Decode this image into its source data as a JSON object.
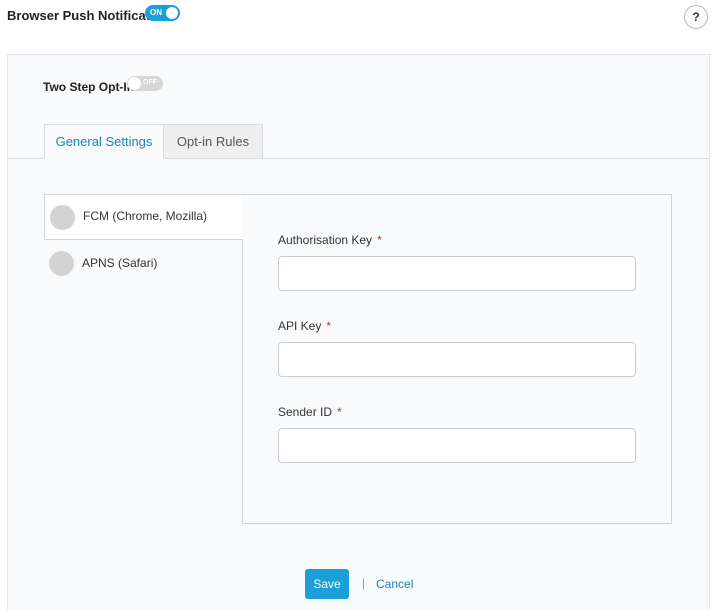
{
  "header": {
    "title": "Browser Push Notification",
    "toggle_label": "ON",
    "help_label": "?"
  },
  "two_step": {
    "label": "Two Step Opt-In",
    "toggle_label": "OFF"
  },
  "tabs": [
    {
      "label": "General Settings",
      "active": true
    },
    {
      "label": "Opt-in Rules",
      "active": false
    }
  ],
  "providers": [
    {
      "label": "FCM (Chrome, Mozilla)",
      "active": true
    },
    {
      "label": "APNS (Safari)",
      "active": false
    }
  ],
  "form": {
    "fields": [
      {
        "label": "Authorisation Key",
        "required_mark": "*",
        "value": ""
      },
      {
        "label": "API Key",
        "required_mark": "*",
        "value": ""
      },
      {
        "label": "Sender ID",
        "required_mark": "*",
        "value": ""
      }
    ]
  },
  "actions": {
    "save_label": "Save",
    "divider": "|",
    "cancel_label": "Cancel"
  },
  "colors": {
    "accent": "#1a9fd8",
    "link": "#1a84b8",
    "required": "#d9251c"
  }
}
